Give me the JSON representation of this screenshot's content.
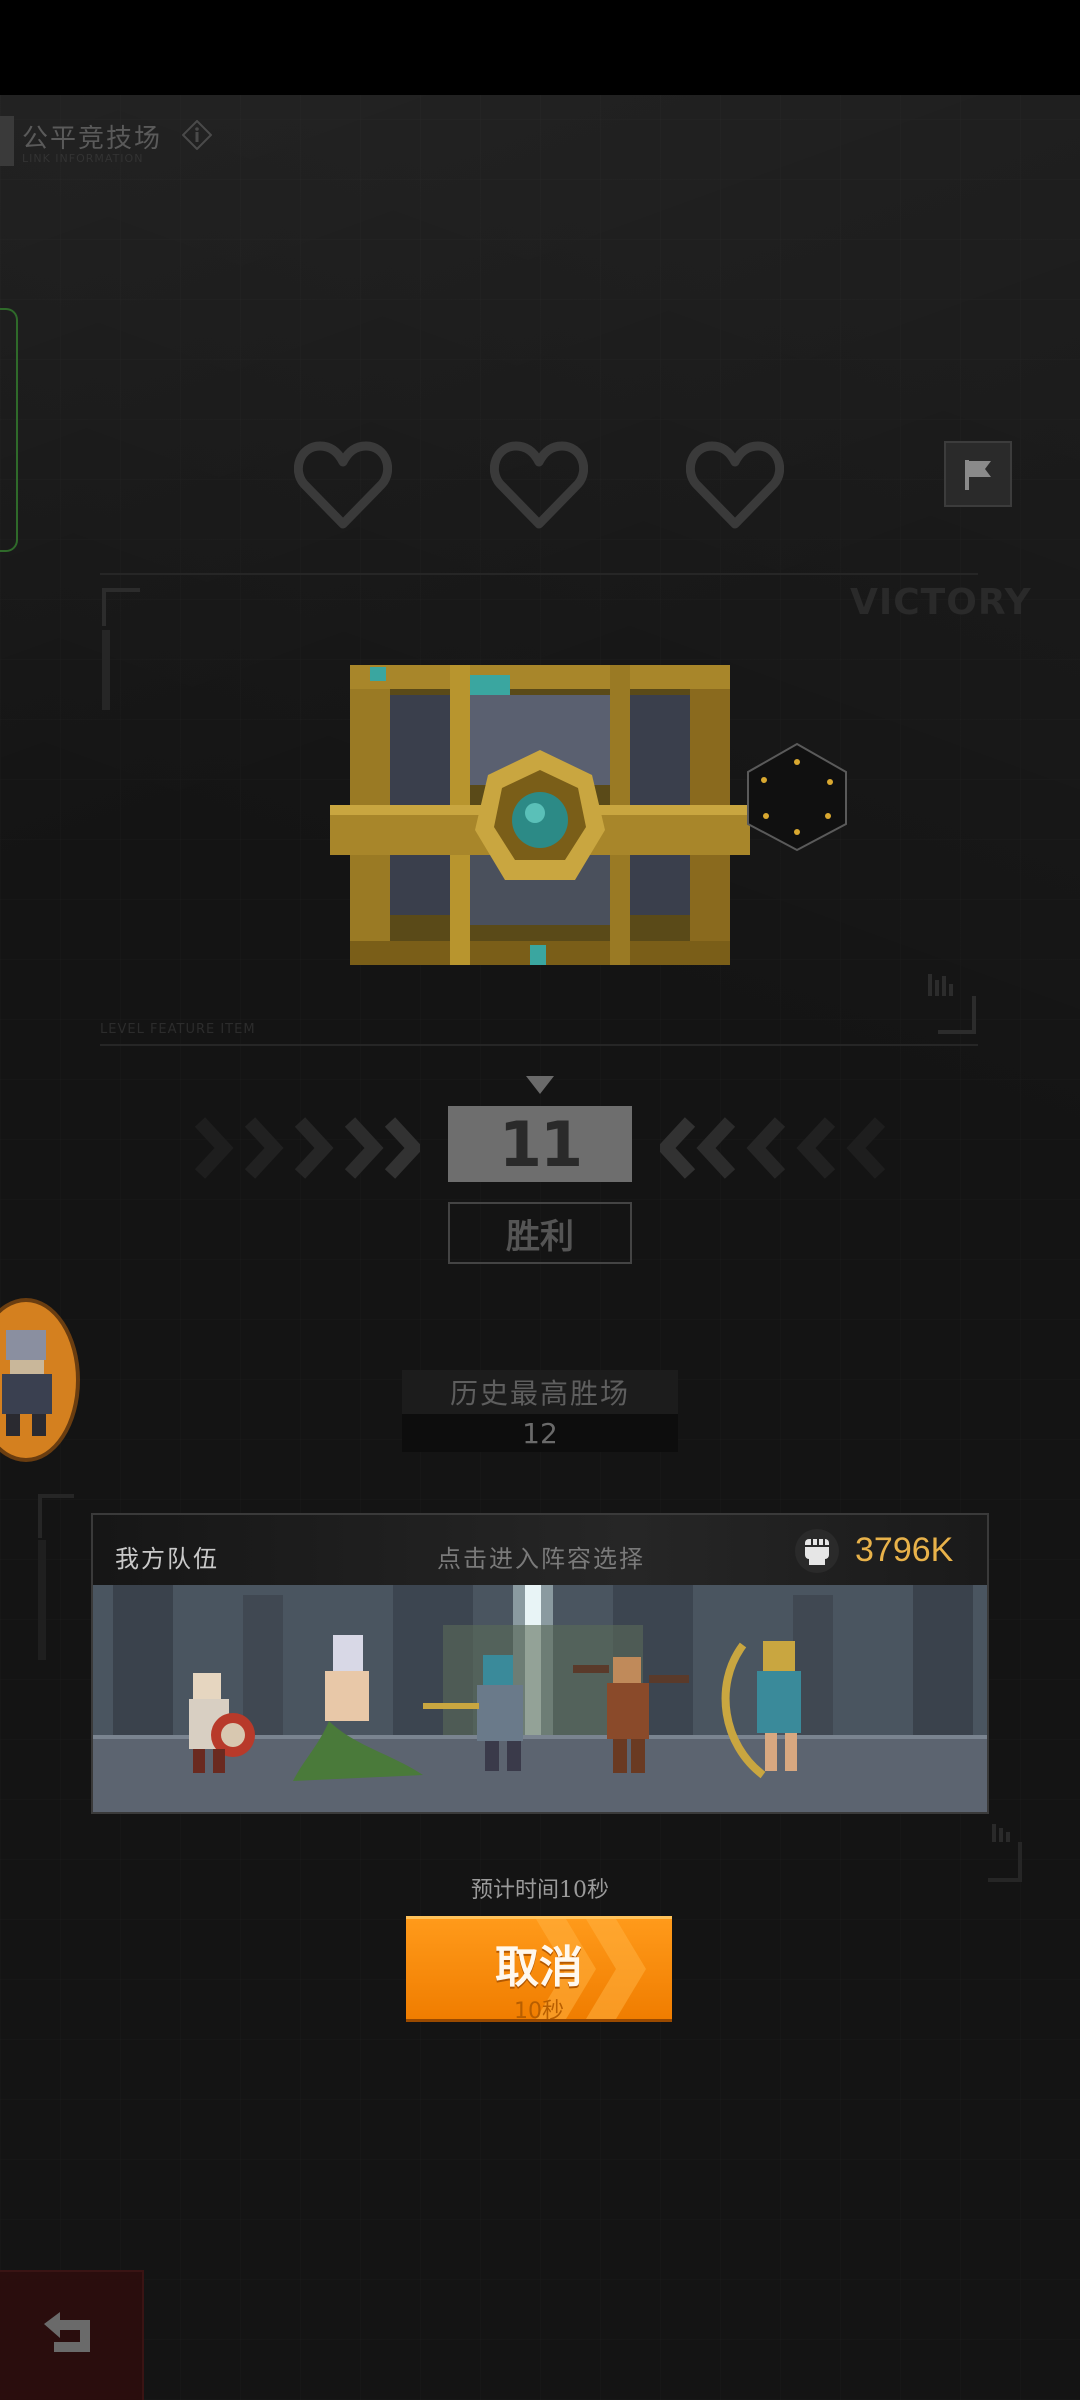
{
  "header": {
    "title": "公平竞技场",
    "subtitle": "LINK INFORMATION",
    "info_icon": "info-icon"
  },
  "lives": {
    "count": 3,
    "icon": "heart-outline-icon"
  },
  "flag_button": {
    "icon": "flag-icon"
  },
  "reward_panel": {
    "victory_text": "VICTORY",
    "caption": "LEVEL FEATURE ITEM",
    "chest_icon": "treasure-chest-icon"
  },
  "wins": {
    "value": "11",
    "label": "胜利"
  },
  "best_record": {
    "label": "历史最高胜场",
    "value": "12"
  },
  "team": {
    "label": "我方队伍",
    "hint": "点击进入阵容选择",
    "power_icon": "fist-icon",
    "power_value": "3796K"
  },
  "matchmaking": {
    "eta": "预计时间10秒",
    "cancel_label": "取消",
    "cancel_timer": "10秒"
  },
  "back_button": {
    "icon": "back-arrow-icon"
  },
  "colors": {
    "accent_orange": "#f58a0a",
    "power_gold": "#e8b24a",
    "background": "#141414"
  }
}
